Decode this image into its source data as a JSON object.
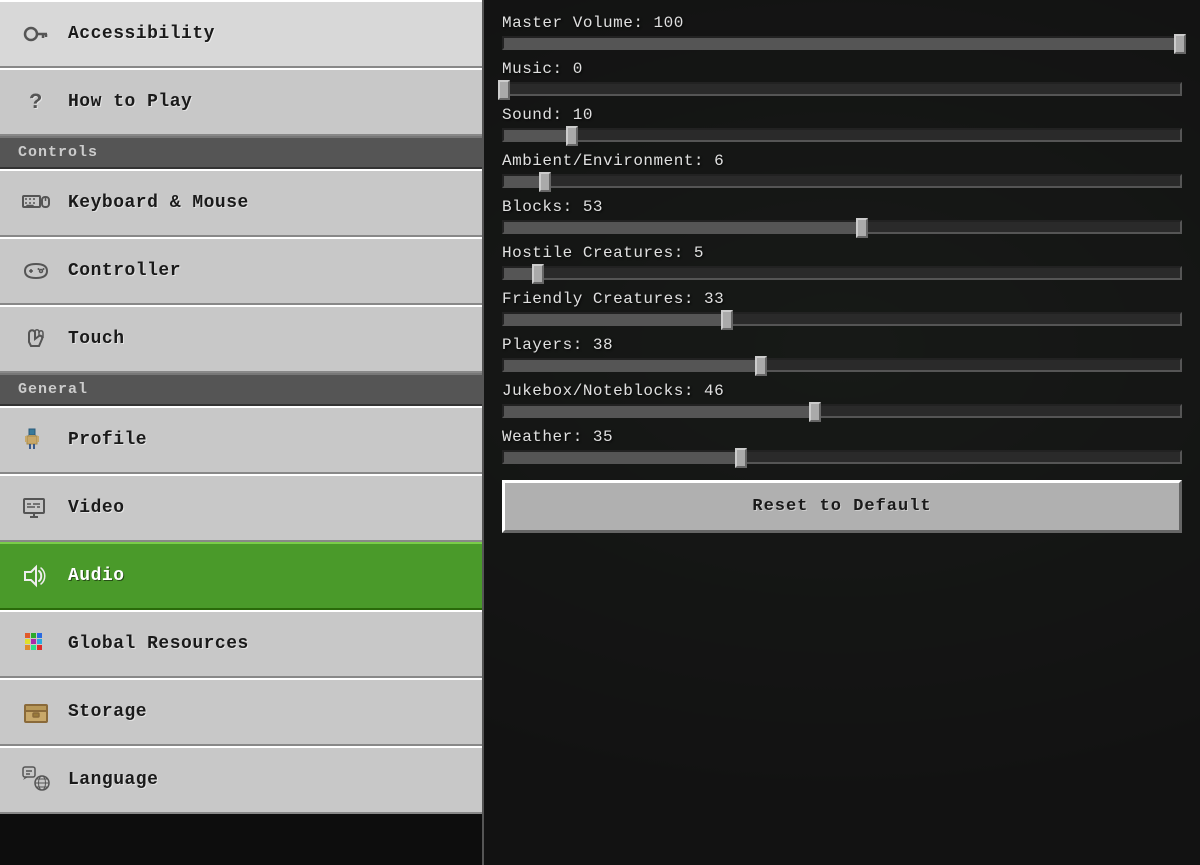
{
  "sidebar": {
    "sections": [
      {
        "items": [
          {
            "id": "accessibility",
            "label": "Accessibility",
            "icon": "key",
            "active": false
          },
          {
            "id": "how-to-play",
            "label": "How to Play",
            "icon": "question",
            "active": false
          }
        ]
      },
      {
        "label": "Controls",
        "items": [
          {
            "id": "keyboard-mouse",
            "label": "Keyboard & Mouse",
            "icon": "keyboard",
            "active": false
          },
          {
            "id": "controller",
            "label": "Controller",
            "icon": "controller",
            "active": false
          },
          {
            "id": "touch",
            "label": "Touch",
            "icon": "touch",
            "active": false
          }
        ]
      },
      {
        "label": "General",
        "items": [
          {
            "id": "profile",
            "label": "Profile",
            "icon": "profile",
            "active": false
          },
          {
            "id": "video",
            "label": "Video",
            "icon": "video",
            "active": false
          },
          {
            "id": "audio",
            "label": "Audio",
            "icon": "audio",
            "active": true
          },
          {
            "id": "global-resources",
            "label": "Global Resources",
            "icon": "resources",
            "active": false
          },
          {
            "id": "storage",
            "label": "Storage",
            "icon": "storage",
            "active": false
          },
          {
            "id": "language",
            "label": "Language",
            "icon": "language",
            "active": false
          }
        ]
      }
    ]
  },
  "content": {
    "sliders": [
      {
        "id": "master-volume",
        "label": "Master Volume",
        "value": 100,
        "pct": 100
      },
      {
        "id": "music",
        "label": "Music",
        "value": 0,
        "pct": 0
      },
      {
        "id": "sound",
        "label": "Sound",
        "value": 10,
        "pct": 10
      },
      {
        "id": "ambient-environment",
        "label": "Ambient/Environment",
        "value": 6,
        "pct": 6
      },
      {
        "id": "blocks",
        "label": "Blocks",
        "value": 53,
        "pct": 53
      },
      {
        "id": "hostile-creatures",
        "label": "Hostile Creatures",
        "value": 5,
        "pct": 5
      },
      {
        "id": "friendly-creatures",
        "label": "Friendly Creatures",
        "value": 33,
        "pct": 33
      },
      {
        "id": "players",
        "label": "Players",
        "value": 38,
        "pct": 38
      },
      {
        "id": "jukebox-noteblocks",
        "label": "Jukebox/Noteblocks",
        "value": 46,
        "pct": 46
      },
      {
        "id": "weather",
        "label": "Weather",
        "value": 35,
        "pct": 35
      }
    ],
    "reset_button_label": "Reset to Default"
  }
}
